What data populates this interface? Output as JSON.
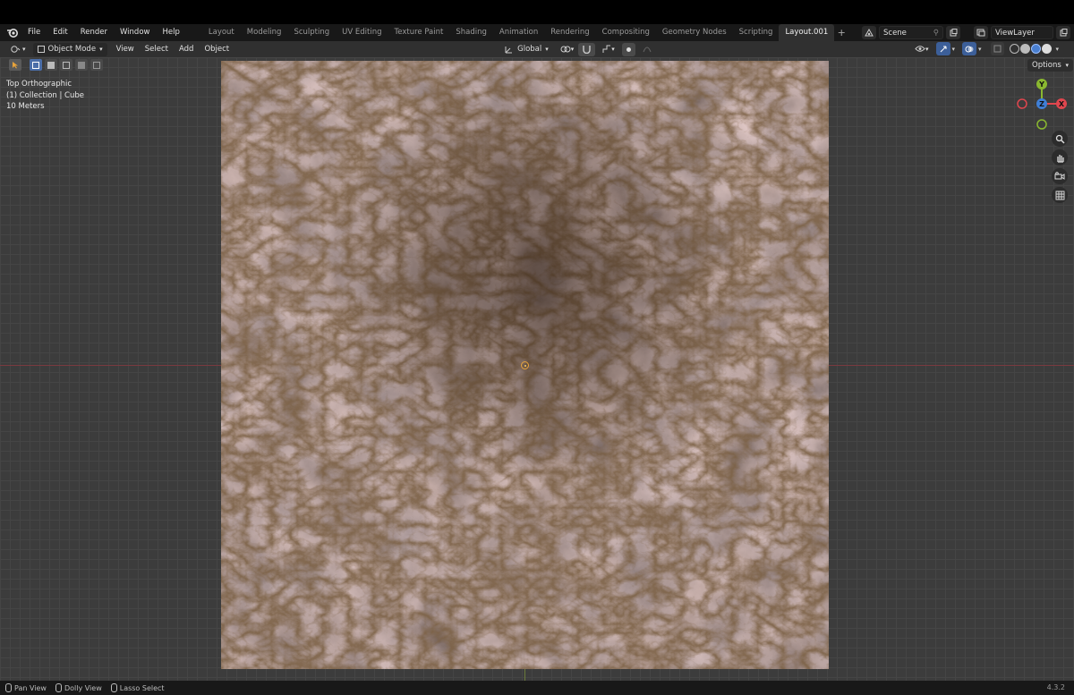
{
  "menubar": {
    "menus": [
      "File",
      "Edit",
      "Render",
      "Window",
      "Help"
    ],
    "workspaces": [
      "Layout",
      "Modeling",
      "Sculpting",
      "UV Editing",
      "Texture Paint",
      "Shading",
      "Animation",
      "Rendering",
      "Compositing",
      "Geometry Nodes",
      "Scripting",
      "Layout.001"
    ],
    "active_workspace": "Layout.001",
    "scene": "Scene",
    "view_layer": "ViewLayer"
  },
  "viewport_header": {
    "mode": "Object Mode",
    "menus": [
      "View",
      "Select",
      "Add",
      "Object"
    ],
    "orientation": "Global",
    "options_label": "Options"
  },
  "overlay": {
    "view_name": "Top Orthographic",
    "collection": "(1) Collection | Cube",
    "scale": "10 Meters"
  },
  "gizmo": {
    "y": "Y",
    "z": "Z",
    "x": "X",
    "colors": {
      "x": "#e0464e",
      "y": "#8ab830",
      "z": "#3f7fd6"
    }
  },
  "statusbar": {
    "items": [
      "Pan View",
      "Dolly View",
      "Lasso Select"
    ],
    "version": "4.3.2"
  }
}
